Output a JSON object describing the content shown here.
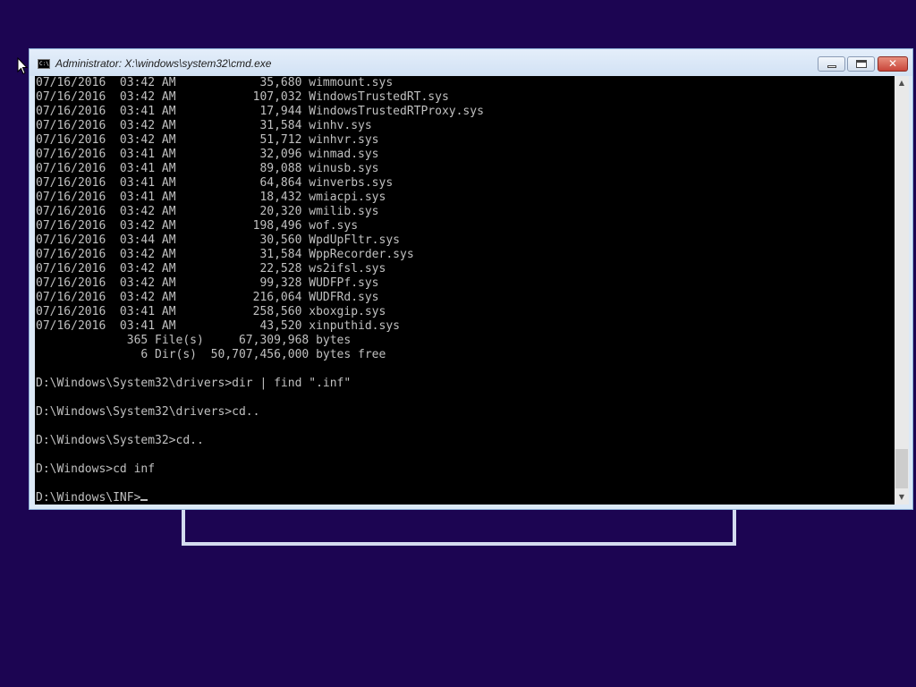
{
  "window": {
    "title": "Administrator: X:\\windows\\system32\\cmd.exe",
    "icon_text": "C:\\",
    "controls": {
      "minimize": "minimize-icon",
      "maximize": "restore-icon",
      "close": "✕"
    }
  },
  "scrollbar": {
    "up": "▲",
    "down": "▼"
  },
  "colors": {
    "desktop": "#1c0552",
    "console_bg": "#000000",
    "console_text": "#c0c0c0",
    "close_button": "#c9463a"
  },
  "console": {
    "lines": [
      "07/16/2016  03:42 AM            35,680 wimmount.sys",
      "07/16/2016  03:42 AM           107,032 WindowsTrustedRT.sys",
      "07/16/2016  03:41 AM            17,944 WindowsTrustedRTProxy.sys",
      "07/16/2016  03:42 AM            31,584 winhv.sys",
      "07/16/2016  03:42 AM            51,712 winhvr.sys",
      "07/16/2016  03:41 AM            32,096 winmad.sys",
      "07/16/2016  03:41 AM            89,088 winusb.sys",
      "07/16/2016  03:41 AM            64,864 winverbs.sys",
      "07/16/2016  03:41 AM            18,432 wmiacpi.sys",
      "07/16/2016  03:42 AM            20,320 wmilib.sys",
      "07/16/2016  03:42 AM           198,496 wof.sys",
      "07/16/2016  03:44 AM            30,560 WpdUpFltr.sys",
      "07/16/2016  03:42 AM            31,584 WppRecorder.sys",
      "07/16/2016  03:42 AM            22,528 ws2ifsl.sys",
      "07/16/2016  03:42 AM            99,328 WUDFPf.sys",
      "07/16/2016  03:42 AM           216,064 WUDFRd.sys",
      "07/16/2016  03:41 AM           258,560 xboxgip.sys",
      "07/16/2016  03:41 AM            43,520 xinputhid.sys",
      "             365 File(s)     67,309,968 bytes",
      "               6 Dir(s)  50,707,456,000 bytes free",
      "",
      "D:\\Windows\\System32\\drivers>dir | find \".inf\"",
      "",
      "D:\\Windows\\System32\\drivers>cd..",
      "",
      "D:\\Windows\\System32>cd..",
      "",
      "D:\\Windows>cd inf",
      ""
    ],
    "prompt": "D:\\Windows\\INF>"
  }
}
